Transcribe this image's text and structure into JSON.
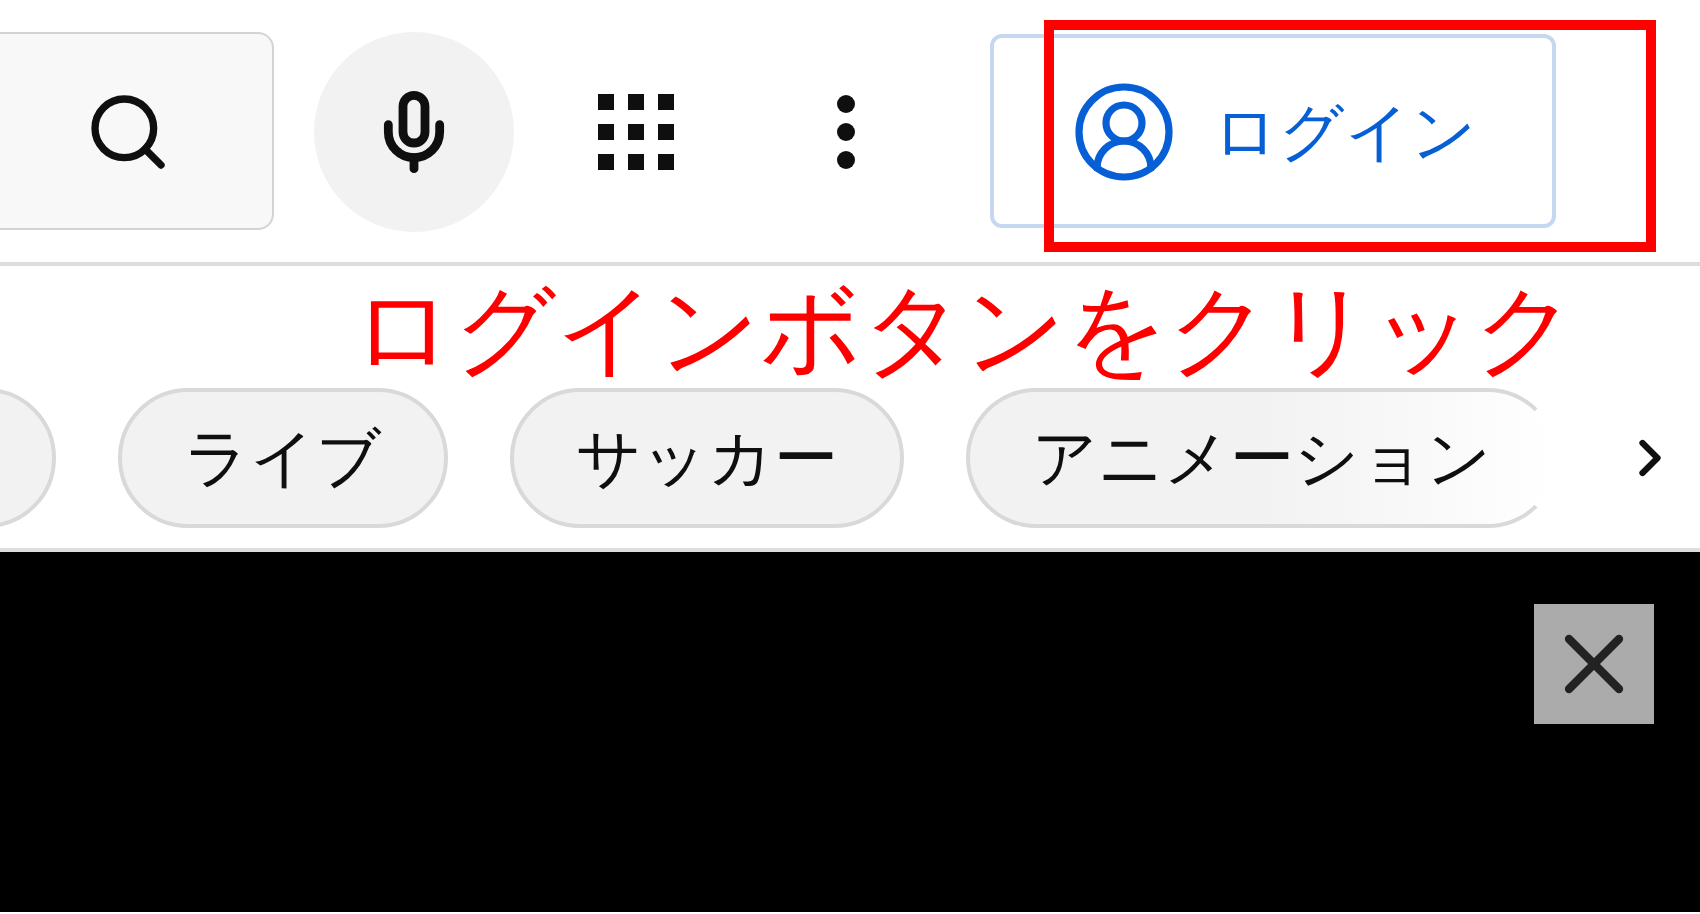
{
  "header": {
    "login_button": {
      "label": "ログイン"
    }
  },
  "annotation": {
    "text": "ログインボタンをクリック"
  },
  "chips": [
    {
      "label": "ライブ"
    },
    {
      "label": "サッカー"
    },
    {
      "label": "アニメーション"
    }
  ]
}
